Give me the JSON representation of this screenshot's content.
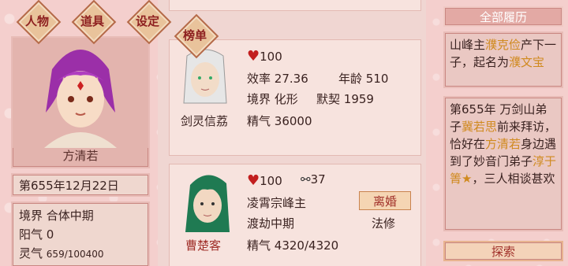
{
  "nav": {
    "characters": "人物",
    "items": "道具",
    "settings": "设定",
    "rankings": "榜单"
  },
  "player": {
    "name": "方清若",
    "date": "第655年12月22日",
    "realm_label": "境界",
    "realm": "合体中期",
    "yang_label": "阳气",
    "yang": "0",
    "spirit_label": "灵气",
    "spirit": "659/100400"
  },
  "partners": [
    {
      "name": "剑灵信荔",
      "affection": "100",
      "efficiency_label": "效率",
      "efficiency": "27.36",
      "age_label": "年龄",
      "age": "510",
      "realm_label": "境界",
      "realm": "化形",
      "tacit_label": "默契",
      "tacit": "1959",
      "essence_label": "精气",
      "essence": "36000"
    },
    {
      "name": "曹楚客",
      "affection": "100",
      "bond": "37",
      "title": "凌霄宗峰主",
      "realm": "渡劫中期",
      "path": "法修",
      "essence_label": "精气",
      "essence": "4320/4320",
      "divorce_label": "离婚"
    }
  ],
  "history": {
    "header": "全部履历",
    "entry1": {
      "p1": "山峰主",
      "n1": "濮克俭",
      "p2": "产下一子，起名为",
      "n2": "濮文宝"
    },
    "entry2": {
      "p1": "第655年 万剑山弟子",
      "n1": "冀若思",
      "p2": "前来拜访，恰好在",
      "n2": "方清若",
      "p3": "身边遇到了妙音门弟子",
      "n3": "淳于箐★",
      "p4": "，三人相谈甚欢"
    },
    "explore_label": "探索"
  },
  "colors": {
    "accent_red": "#c21e1e",
    "highlight": "#d08a1f"
  }
}
